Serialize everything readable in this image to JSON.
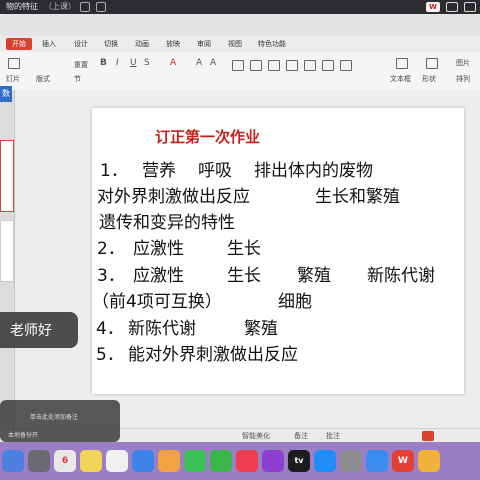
{
  "window": {
    "doc_tab_title": "物的特征",
    "doc_tab_status": "（上课）",
    "app_badge": "W"
  },
  "ribbon": {
    "tabs": [
      "开始",
      "插入",
      "设计",
      "切换",
      "动画",
      "放映",
      "审阅",
      "视图",
      "特色功能"
    ],
    "tools": {
      "reset": "重置",
      "new_slide": "灯片",
      "layout": "版式",
      "section": "节",
      "textbox": "文本框",
      "shape": "形状",
      "arrange": "排列",
      "picture": "图片"
    }
  },
  "left_panel": {
    "tab_label": "数"
  },
  "slide": {
    "title": "订正第一次作业",
    "lines": [
      [
        "1．",
        "营养",
        "呼吸",
        "排出体内的废物"
      ],
      [
        "对外界刺激做出反应",
        "生长和繁殖"
      ],
      [
        "遗传和变异的特性"
      ],
      [
        "2．",
        "应激性",
        "生长"
      ],
      [
        "3．",
        "应激性",
        "生长",
        "繁殖",
        "新陈代谢"
      ],
      [
        "（前4项可互换）",
        "细胞"
      ],
      [
        "4．",
        "新陈代谢",
        "繁殖"
      ],
      [
        "5．",
        "能对外界刺激做出反应"
      ]
    ]
  },
  "status_bar": {
    "smart_beautify": "智能美化",
    "notes": "备注",
    "comments": "批注"
  },
  "overlay": {
    "speaker_name": "老师好",
    "hint_1": "单击此处添加备注",
    "hint_2": "本地备份开"
  },
  "dock": {
    "calendar_day": "6",
    "app_label_tv": "tv",
    "app_label_wps": "W"
  },
  "colors": {
    "accent_red": "#d9412f",
    "title_red": "#c6221b",
    "dock_purple": "#9b7fc4"
  }
}
